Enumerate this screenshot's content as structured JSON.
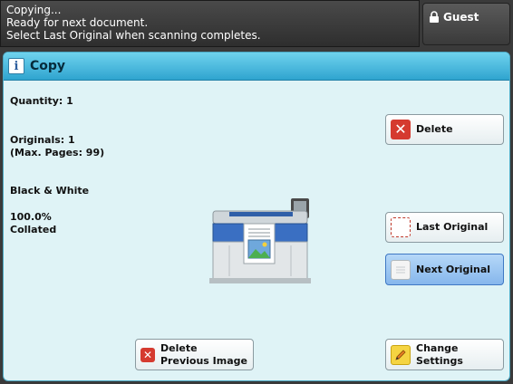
{
  "status": {
    "lines": [
      "Copying...",
      "Ready for next document.",
      "Select Last Original when scanning completes."
    ]
  },
  "guest": {
    "label": "Guest",
    "icon": "lock-icon"
  },
  "panel": {
    "title": "Copy",
    "icon": "info-icon"
  },
  "info": {
    "quantity": "Quantity:  1",
    "originals": "Originals:  1",
    "max_pages": "(Max. Pages:  99)",
    "color_mode": "Black & White",
    "scale": "100.0%",
    "collation": "Collated"
  },
  "buttons": {
    "delete": "Delete",
    "last_original": "Last Original",
    "next_original": "Next Original",
    "delete_prev_line1": "Delete",
    "delete_prev_line2": "Previous Image",
    "change_line1": "Change",
    "change_line2": "Settings"
  },
  "colors": {
    "panel_bg": "#dff3f6",
    "title_bar": "#2fa4cf",
    "active_button": "#86b6ec",
    "delete_red": "#d53a2f"
  }
}
